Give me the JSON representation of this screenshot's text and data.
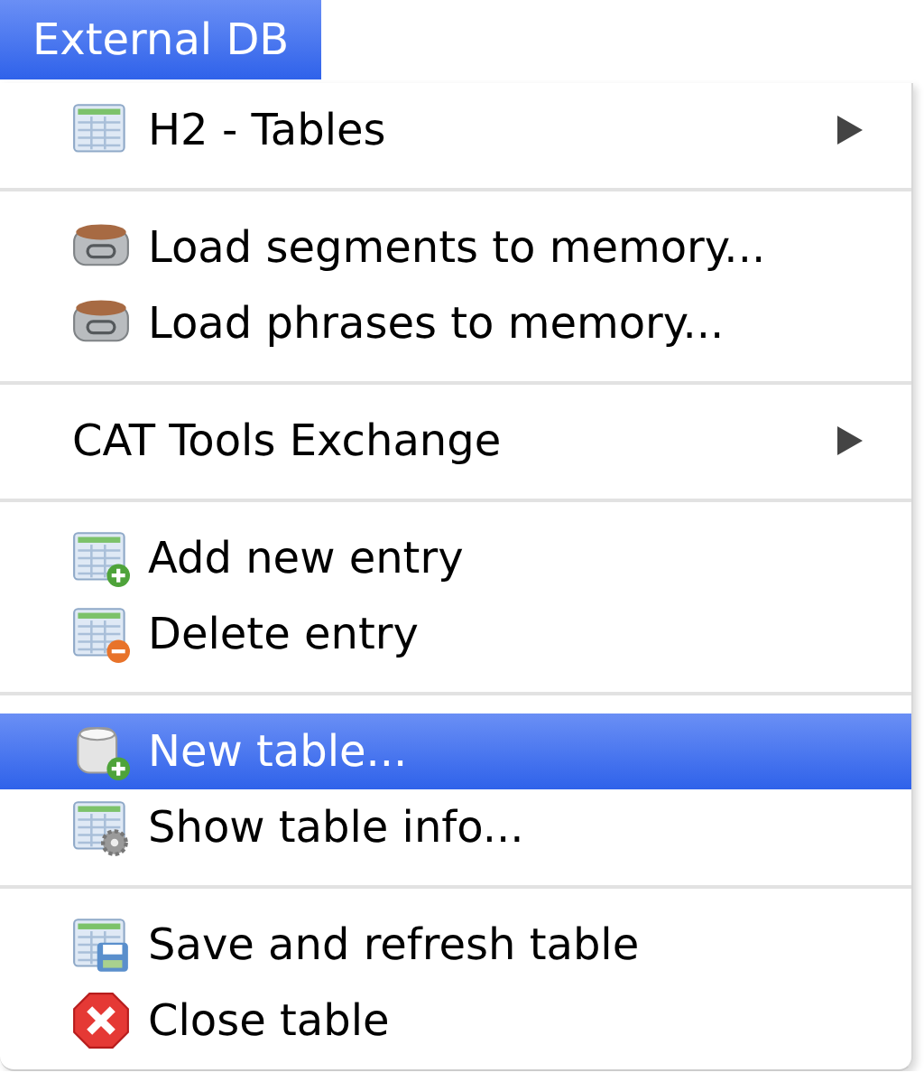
{
  "menu_title": {
    "label": "External DB",
    "selected": true
  },
  "items": [
    {
      "kind": "item",
      "label": "H2 - Tables",
      "submenu": true,
      "selected": false
    },
    {
      "kind": "separator"
    },
    {
      "kind": "item",
      "label": "Load segments to memory...",
      "submenu": false,
      "selected": false
    },
    {
      "kind": "item",
      "label": "Load phrases to memory...",
      "submenu": false,
      "selected": false
    },
    {
      "kind": "separator"
    },
    {
      "kind": "item",
      "label": "CAT Tools Exchange",
      "submenu": true,
      "selected": false
    },
    {
      "kind": "separator"
    },
    {
      "kind": "item",
      "label": "Add new entry",
      "submenu": false,
      "selected": false
    },
    {
      "kind": "item",
      "label": "Delete entry",
      "submenu": false,
      "selected": false
    },
    {
      "kind": "separator"
    },
    {
      "kind": "item",
      "label": "New table...",
      "submenu": false,
      "selected": true
    },
    {
      "kind": "item",
      "label": "Show table info...",
      "submenu": false,
      "selected": false
    },
    {
      "kind": "separator"
    },
    {
      "kind": "item",
      "label": "Save and refresh table",
      "submenu": false,
      "selected": false
    },
    {
      "kind": "item",
      "label": "Close table",
      "submenu": false,
      "selected": false
    }
  ]
}
